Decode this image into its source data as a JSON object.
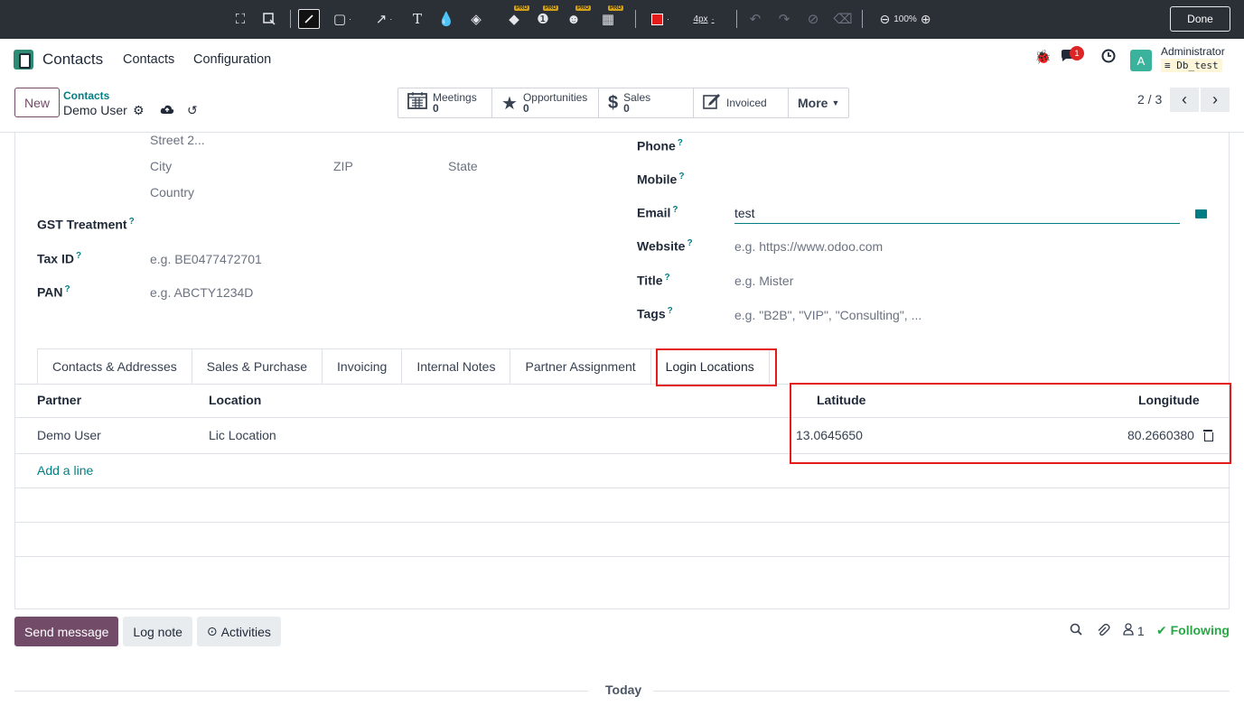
{
  "annotation_toolbar": {
    "zoom": "100%",
    "stroke": "4px",
    "done_label": "Done",
    "pro_label": "PRO",
    "colors": {
      "bg": "#2b2f36",
      "red_swatch": "#e31b1b"
    }
  },
  "navbar": {
    "app_name": "Contacts",
    "menu": [
      "Contacts",
      "Configuration"
    ],
    "notification_count": "1",
    "avatar_letter": "A",
    "user": "Administrator",
    "db": "Db_test"
  },
  "control_panel": {
    "new_label": "New",
    "breadcrumb_parent": "Contacts",
    "breadcrumb_current": "Demo User",
    "stats": [
      {
        "label": "Meetings",
        "count": "0",
        "icon": "calendar-icon"
      },
      {
        "label": "Opportunities",
        "count": "0",
        "icon": "star-icon"
      },
      {
        "label": "Sales",
        "count": "0",
        "icon": "dollar-icon"
      },
      {
        "label": "Invoiced",
        "count": "",
        "icon": "edit-icon"
      }
    ],
    "more_label": "More",
    "pager": "2 / 3"
  },
  "form": {
    "address": {
      "street2": "Street 2...",
      "city": "City",
      "zip": "ZIP",
      "state": "State",
      "country": "Country"
    },
    "gst_label": "GST Treatment",
    "tax_label": "Tax ID",
    "tax_placeholder": "e.g. BE0477472701",
    "pan_label": "PAN",
    "pan_placeholder": "e.g. ABCTY1234D",
    "phone_label": "Phone",
    "mobile_label": "Mobile",
    "email_label": "Email",
    "email_value": "test",
    "website_label": "Website",
    "website_placeholder": "e.g. https://www.odoo.com",
    "title_label": "Title",
    "title_placeholder": "e.g. Mister",
    "tags_label": "Tags",
    "tags_placeholder": "e.g. \"B2B\", \"VIP\", \"Consulting\", ..."
  },
  "tabs": [
    "Contacts & Addresses",
    "Sales & Purchase",
    "Invoicing",
    "Internal Notes",
    "Partner Assignment",
    "Login Locations"
  ],
  "login_table": {
    "headers": {
      "partner": "Partner",
      "location": "Location",
      "latitude": "Latitude",
      "longitude": "Longitude"
    },
    "rows": [
      {
        "partner": "Demo User",
        "location": "Lic Location",
        "latitude": "13.0645650",
        "longitude": "80.2660380"
      }
    ],
    "add_line": "Add a line"
  },
  "chatter": {
    "send_message": "Send message",
    "log_note": "Log note",
    "activities": "Activities",
    "followers_count": "1",
    "following": "Following",
    "today": "Today"
  }
}
